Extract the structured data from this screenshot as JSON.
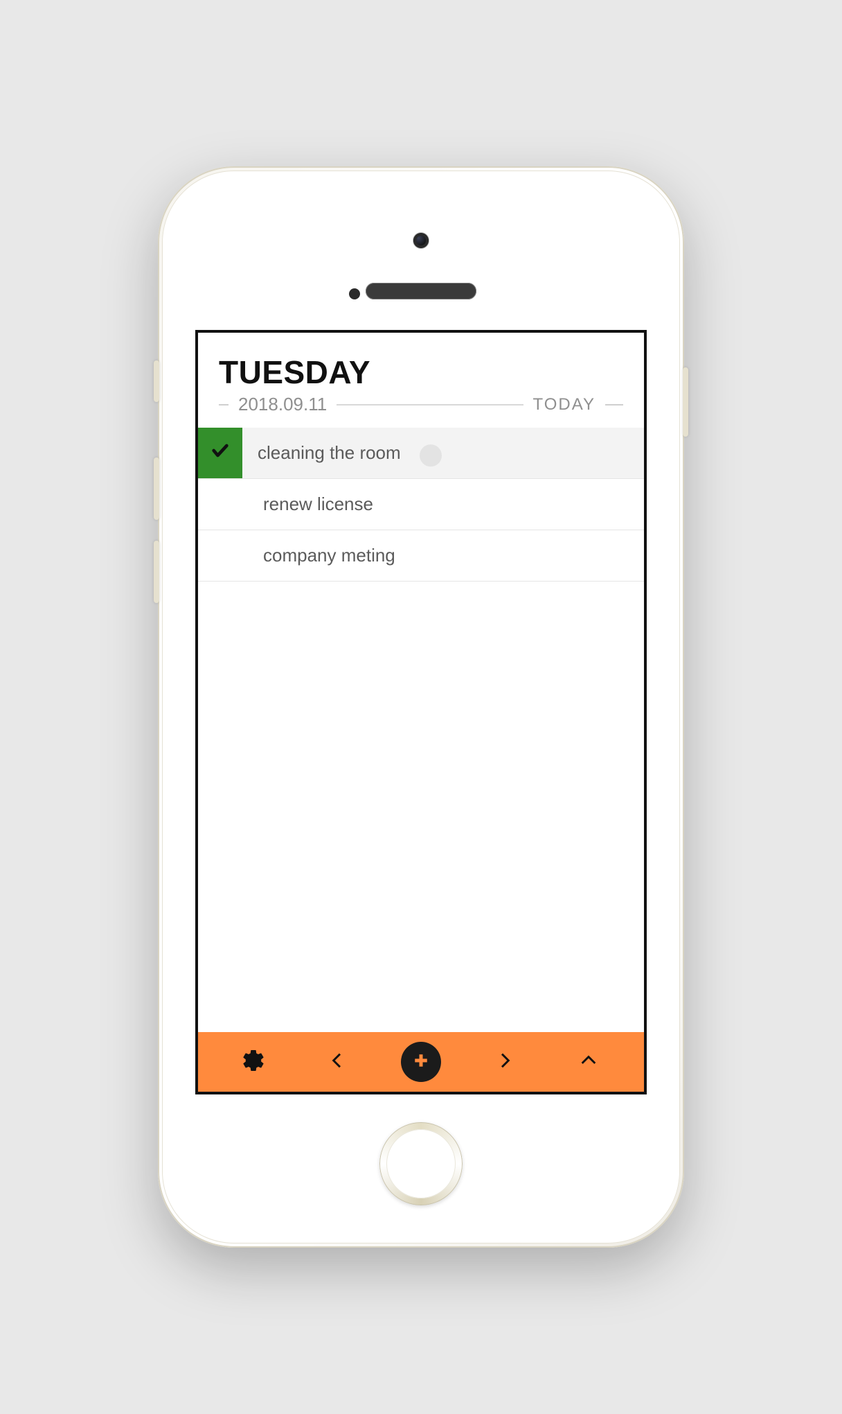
{
  "header": {
    "day": "TUESDAY",
    "date": "2018.09.11",
    "today_label": "TODAY"
  },
  "tasks": [
    {
      "label": "cleaning the room",
      "done": true,
      "showKnob": true
    },
    {
      "label": "renew license",
      "done": false,
      "showKnob": false
    },
    {
      "label": "company meting",
      "done": false,
      "showKnob": false
    }
  ],
  "colors": {
    "accent": "#ff8a3d",
    "done": "#338f2b"
  }
}
